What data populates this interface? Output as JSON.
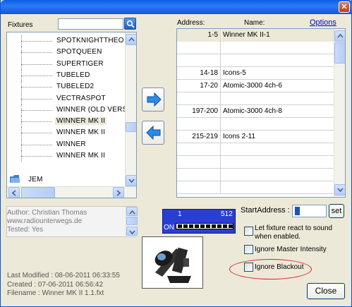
{
  "fixtures_label": "Fixtures",
  "search": {
    "value": ""
  },
  "tree": {
    "items": [
      {
        "label": "SPOTKNIGHTTHEO",
        "selected": false
      },
      {
        "label": "SPOTQUEEN",
        "selected": false
      },
      {
        "label": "SUPERTIGER",
        "selected": false
      },
      {
        "label": "TUBELED",
        "selected": false
      },
      {
        "label": "TUBELED2",
        "selected": false
      },
      {
        "label": "VECTRASPOT",
        "selected": false
      },
      {
        "label": "WINNER (OLD VERSIO",
        "selected": false
      },
      {
        "label": "WINNER MK II",
        "selected": true
      },
      {
        "label": "WINNER MK II",
        "selected": false
      },
      {
        "label": "WINNER",
        "selected": false
      },
      {
        "label": "WINNER MK II",
        "selected": false
      }
    ],
    "folder_label": "JEM"
  },
  "info": {
    "author": "Author: Christian Thomas",
    "website": "www.radiounterwegs.de",
    "tested": "Tested: Yes"
  },
  "meta": {
    "last_modified": "Last Modified : 08-06-2011 06:33:55",
    "created": "Created : 07-06-2011 06:56:42",
    "filename": "Filename : Winner MK II 1.1.fxt"
  },
  "table": {
    "address_header": "Address:",
    "name_header": "Name:",
    "options_link": "Options",
    "rows": [
      {
        "address": "1-5",
        "name": "Winner MK II-1"
      },
      {
        "address": "",
        "name": ""
      },
      {
        "address": "",
        "name": ""
      },
      {
        "address": "14-18",
        "name": "Icons-5"
      },
      {
        "address": "17-20",
        "name": "Atomic-3000 4ch-6"
      },
      {
        "address": "",
        "name": ""
      },
      {
        "address": "197-200",
        "name": "Atomic-3000 4ch-8"
      },
      {
        "address": "",
        "name": ""
      },
      {
        "address": "215-219",
        "name": "Icons 2-11"
      },
      {
        "address": "",
        "name": ""
      },
      {
        "address": "",
        "name": ""
      },
      {
        "address": "",
        "name": ""
      },
      {
        "address": "",
        "name": ""
      }
    ]
  },
  "dmx": {
    "start": "1",
    "end": "512",
    "on": "ON"
  },
  "start_address": {
    "label": "StartAddress :",
    "value": "1",
    "set_label": "set"
  },
  "options": {
    "sound": "Let fixture react to sound when enabled.",
    "sound_checked": false,
    "ignore_master": "Ignore Master Intensity",
    "ignore_master_checked": false,
    "ignore_blackout": "Ignore Blackout",
    "ignore_blackout_checked": false
  },
  "close_label": "Close",
  "colors": {
    "title_bar": "#0a5ee8",
    "dmx_panel": "#2a3fd0",
    "highlight_ellipse": "#dd2222"
  }
}
